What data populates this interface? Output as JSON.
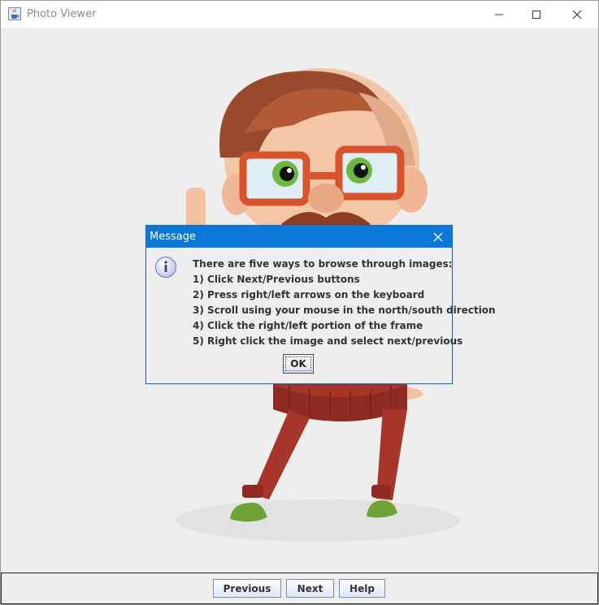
{
  "window": {
    "title": "Photo Viewer",
    "app_icon": "java-cup-icon",
    "controls": {
      "minimize": "minimize-icon",
      "maximize": "maximize-icon",
      "close": "close-icon"
    }
  },
  "photo": {
    "subject": "cartoon hipster man with glasses and mustache"
  },
  "dialog": {
    "title": "Message",
    "icon": "info-icon",
    "lines": [
      "There are five ways to browse through images:",
      "1) Click Next/Previous buttons",
      "2) Press right/left arrows on the keyboard",
      "3) Scroll using your mouse in the north/south direction",
      "4) Click the right/left portion of the frame",
      "5) Right click the image and select next/previous"
    ],
    "ok_label": "OK"
  },
  "nav": {
    "previous_label": "Previous",
    "next_label": "Next",
    "help_label": "Help"
  },
  "colors": {
    "dialog_title_bg": "#0b78d7",
    "background": "#eeeeee"
  }
}
